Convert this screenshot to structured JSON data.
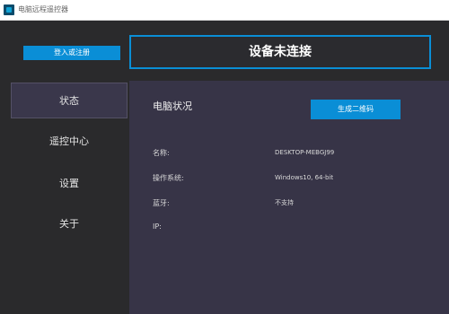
{
  "window": {
    "title": "电脑远程遥控器",
    "icon": "app-logo-icon"
  },
  "sidebar": {
    "login_label": "登入或注册",
    "items": [
      {
        "label": "状态",
        "active": true
      },
      {
        "label": "遥控中心",
        "active": false
      },
      {
        "label": "设置",
        "active": false
      },
      {
        "label": "关于",
        "active": false
      }
    ]
  },
  "connection": {
    "status": "设备未连接"
  },
  "main": {
    "section_title": "电脑状况",
    "qr_button": "生成二维码",
    "info": [
      {
        "label": "名称:",
        "value": "DESKTOP-MEBGJ99"
      },
      {
        "label": "操作系统:",
        "value": "Windows10, 64-bit"
      },
      {
        "label": "蓝牙:",
        "value": "不支持"
      },
      {
        "label": "IP:",
        "value": ""
      }
    ]
  },
  "colors": {
    "accent": "#0a8ed6",
    "panel": "#373447",
    "background": "#2a2a2c",
    "titlebar": "#ffffff"
  }
}
